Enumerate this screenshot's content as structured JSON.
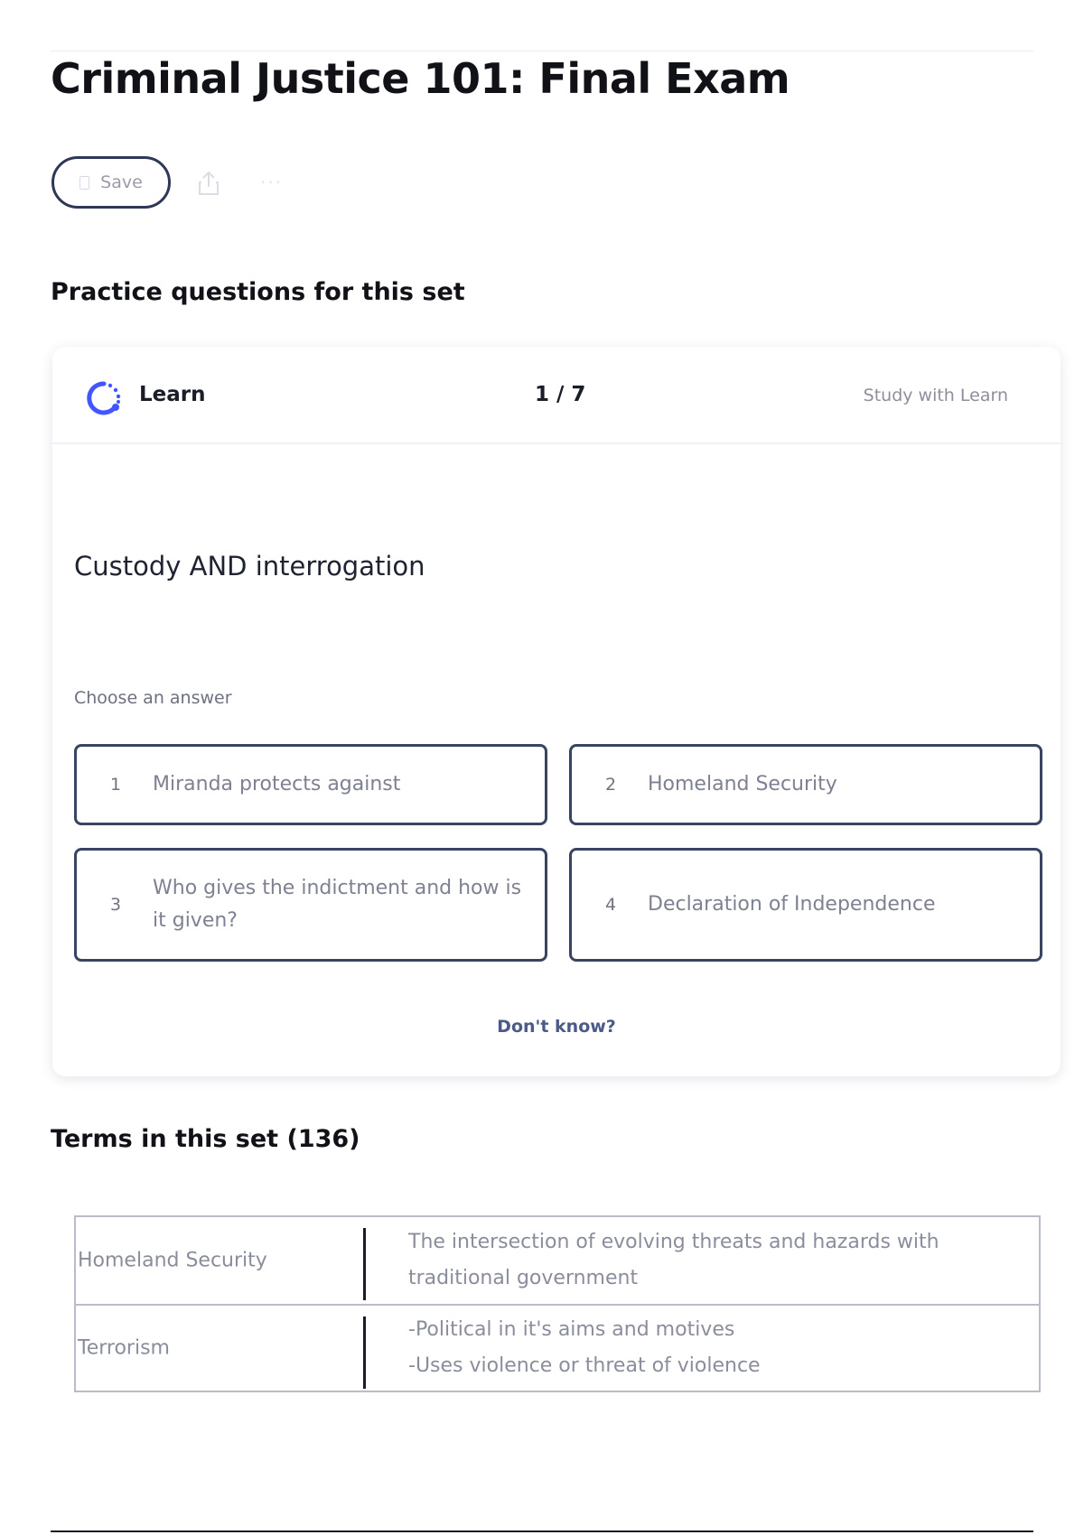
{
  "page": {
    "title": "Criminal Justice 101: Final Exam"
  },
  "toolbar": {
    "save_label": "Save",
    "more_label": "···"
  },
  "practice": {
    "section_title": "Practice questions for this set",
    "mode_label": "Learn",
    "progress": "1 / 7",
    "study_link": "Study with Learn",
    "question": "Custody AND interrogation",
    "choose_label": "Choose an answer",
    "options": [
      {
        "number": "1",
        "text": "Miranda protects against"
      },
      {
        "number": "2",
        "text": "Homeland Security"
      },
      {
        "number": "3",
        "text": "Who gives the indictment and how is it given?"
      },
      {
        "number": "4",
        "text": "Declaration of Independence"
      }
    ],
    "dont_know": "Don't know?"
  },
  "terms": {
    "section_title": "Terms in this set (136)",
    "rows": [
      {
        "term": "Homeland Security",
        "definition_lines": [
          "The intersection of evolving threats and hazards with",
          "traditional government"
        ]
      },
      {
        "term": "Terrorism",
        "definition_lines": [
          "-Political in it's aims and motives",
          "-Uses violence or threat of violence"
        ]
      }
    ]
  },
  "colors": {
    "accent_blue": "#4255ff",
    "button_border": "#2e3856",
    "dont_know_text": "#4b5a86"
  },
  "icons": {
    "save": "bookmark-icon",
    "share": "share-icon",
    "more": "more-icon",
    "learn": "learn-mode-icon"
  }
}
